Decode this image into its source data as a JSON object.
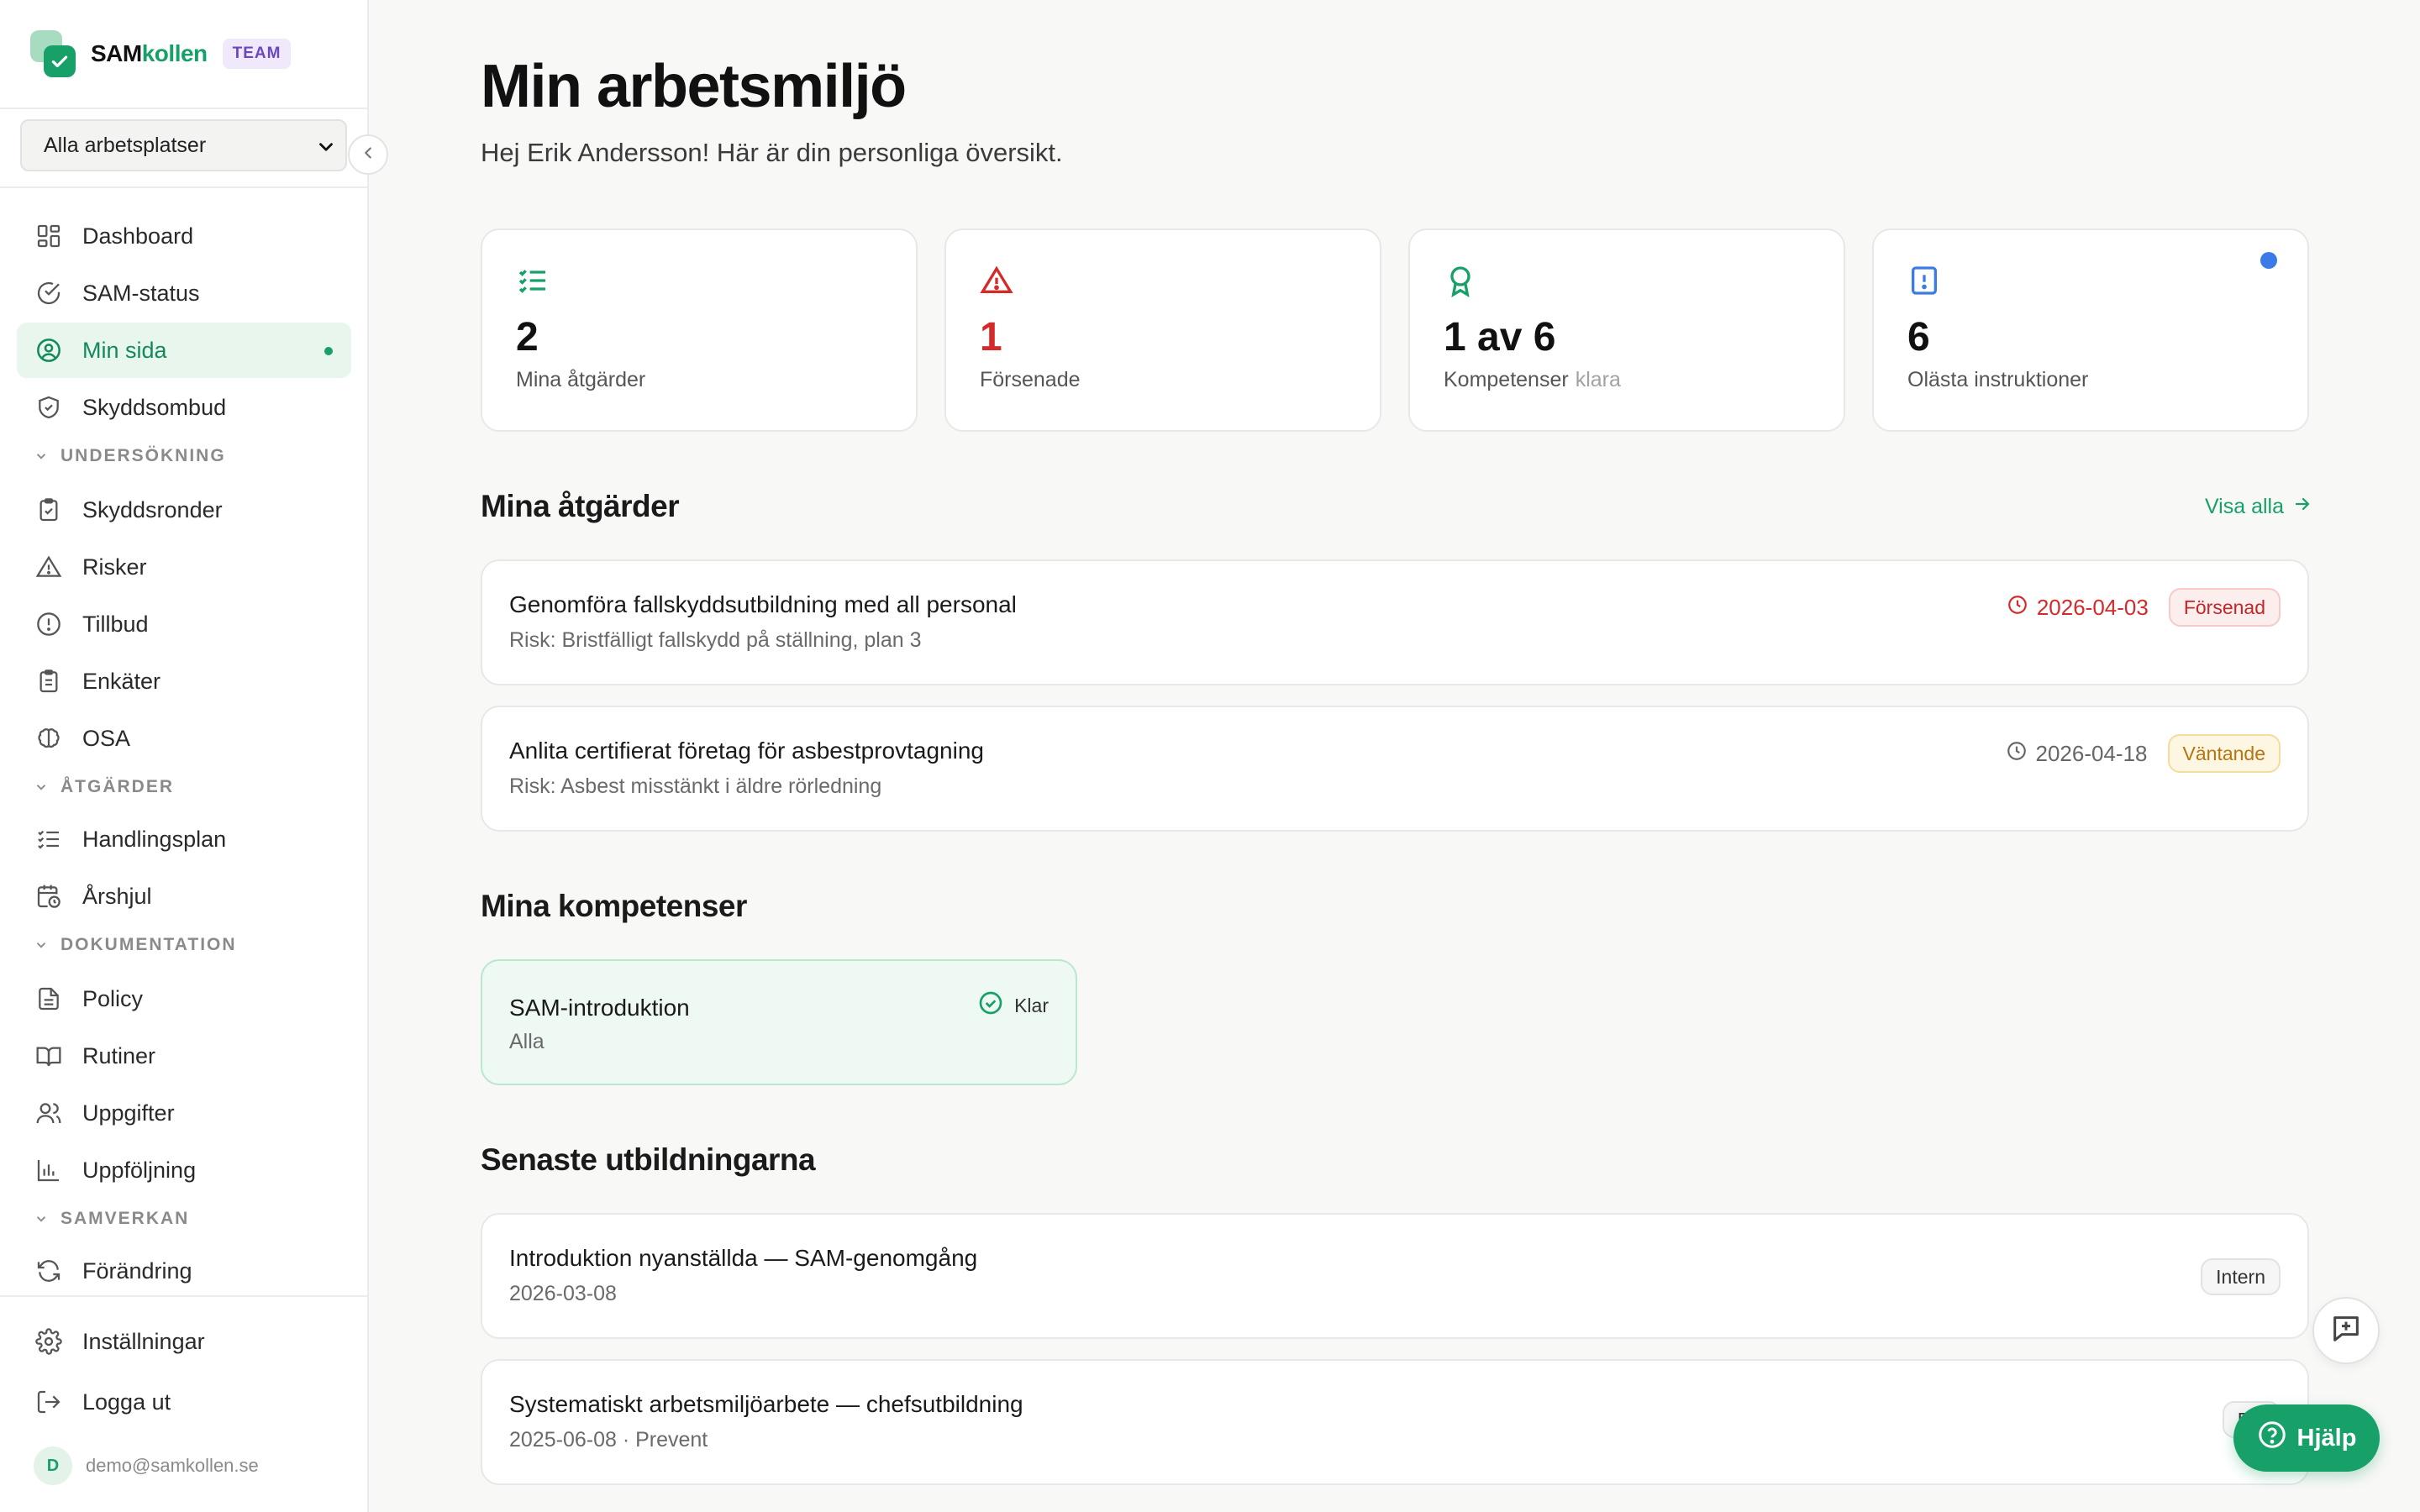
{
  "brand": {
    "name_part1": "SAM",
    "name_part2": "kollen",
    "badge": "TEAM"
  },
  "workplace_select": {
    "value": "Alla arbetsplatser"
  },
  "nav": {
    "dashboard": "Dashboard",
    "sam_status": "SAM-status",
    "min_sida": "Min sida",
    "skyddsombud": "Skyddsombud",
    "section_undersokning": "UNDERSÖKNING",
    "skyddsronder": "Skyddsronder",
    "risker": "Risker",
    "tillbud": "Tillbud",
    "enkater": "Enkäter",
    "osa": "OSA",
    "section_atgarder": "ÅTGÄRDER",
    "handlingsplan": "Handlingsplan",
    "arshjul": "Årshjul",
    "section_dokumentation": "DOKUMENTATION",
    "policy": "Policy",
    "rutiner": "Rutiner",
    "uppgifter": "Uppgifter",
    "uppfoljning": "Uppföljning",
    "section_samverkan": "SAMVERKAN",
    "forandring": "Förändring",
    "installningar": "Inställningar",
    "logga_ut": "Logga ut"
  },
  "user": {
    "avatar_initial": "D",
    "email": "demo@samkollen.se"
  },
  "page": {
    "title": "Min arbetsmiljö",
    "subtitle": "Hej Erik Andersson! Här är din personliga översikt."
  },
  "stats": [
    {
      "icon": "checklist-icon",
      "value": "2",
      "label": "Mina åtgärder"
    },
    {
      "icon": "warning-icon",
      "value": "1",
      "label": "Försenade",
      "color": "#d42a2a"
    },
    {
      "icon": "award-icon",
      "value": "1 av 6",
      "label": "Kompetenser",
      "label_muted": "klara"
    },
    {
      "icon": "document-alert-icon",
      "value": "6",
      "label": "Olästa instruktioner",
      "indicator_color": "#3b7be8"
    }
  ],
  "actions": {
    "title": "Mina åtgärder",
    "view_all": "Visa alla",
    "items": [
      {
        "title": "Genomföra fallskyddsutbildning med all personal",
        "risk": "Risk: Bristfälligt fallskydd på ställning, plan 3",
        "date": "2026-04-03",
        "status": "Försenad"
      },
      {
        "title": "Anlita certifierat företag för asbestprovtagning",
        "risk": "Risk: Asbest misstänkt i äldre rörledning",
        "date": "2026-04-18",
        "status": "Väntande"
      }
    ]
  },
  "competences": {
    "title": "Mina kompetenser",
    "items": [
      {
        "title": "SAM-introduktion",
        "sub": "Alla",
        "status": "Klar"
      }
    ]
  },
  "trainings": {
    "title": "Senaste utbildningarna",
    "items": [
      {
        "title": "Introduktion nyanställda — SAM-genomgång",
        "sub": "2026-03-08",
        "tag": "Intern"
      },
      {
        "title": "Systematiskt arbetsmiljöarbete — chefsutbildning",
        "sub": "2025-06-08 · Prevent",
        "tag": "Ext"
      }
    ]
  },
  "help_button": "Hjälp",
  "colors": {
    "accent": "#17a067",
    "danger": "#d42a2a",
    "warning": "#b8740e",
    "info": "#3b7be8"
  }
}
